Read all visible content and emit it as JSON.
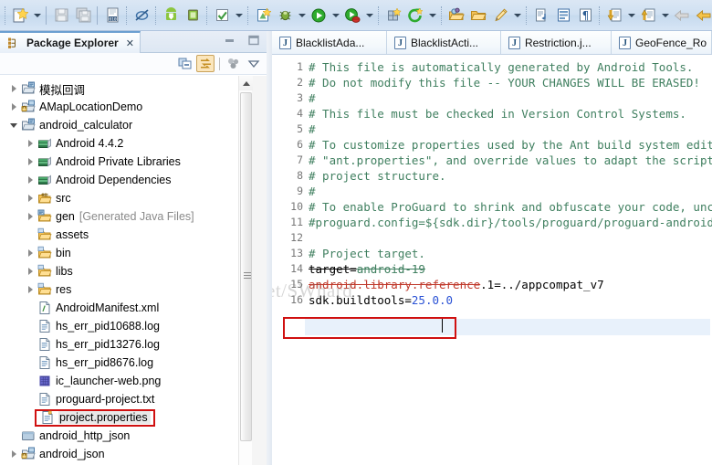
{
  "toolbar": {
    "items": [
      {
        "name": "new-wizard-button",
        "icon": "new-file-icon",
        "arrow": true
      },
      {
        "sep": "solid"
      },
      {
        "name": "save-button",
        "icon": "save-icon",
        "arrow": false
      },
      {
        "name": "save-all-button",
        "icon": "save-all-icon",
        "arrow": false
      },
      {
        "sep": "bar"
      },
      {
        "name": "open-hex-button",
        "icon": "binary-file-icon",
        "arrow": false
      },
      {
        "sep": "dot"
      },
      {
        "name": "skip-breakpoints-button",
        "icon": "skip-breakpoints-icon",
        "arrow": false
      },
      {
        "sep": "dot"
      },
      {
        "name": "android-sdk-manager-button",
        "icon": "android-download-icon",
        "arrow": false
      },
      {
        "name": "android-avd-manager-button",
        "icon": "android-device-icon",
        "arrow": false
      },
      {
        "sep": "dot"
      },
      {
        "name": "run-lint-button",
        "icon": "checkmark-icon",
        "arrow": true
      },
      {
        "sep": "dot"
      },
      {
        "name": "new-android-project-button",
        "icon": "new-android-icon",
        "arrow": false
      },
      {
        "name": "debug-button",
        "icon": "bug-icon",
        "arrow": true
      },
      {
        "name": "run-button",
        "icon": "run-play-icon",
        "arrow": true
      },
      {
        "name": "run-coverage-button",
        "icon": "coverage-icon",
        "arrow": true
      },
      {
        "sep": "dot"
      },
      {
        "name": "new-java-class-button",
        "icon": "new-class-icon",
        "arrow": false
      },
      {
        "name": "external-tools-button",
        "icon": "green-refresh-icon",
        "arrow": true
      },
      {
        "sep": "dot"
      },
      {
        "name": "open-type-button",
        "icon": "open-folder-search-icon",
        "arrow": false
      },
      {
        "name": "open-resource-button",
        "icon": "open-folder-icon",
        "arrow": false
      },
      {
        "name": "pen-annotate-button",
        "icon": "pen-icon",
        "arrow": true
      },
      {
        "sep": "dot"
      },
      {
        "name": "next-annotation-button",
        "icon": "next-edit-icon",
        "arrow": false
      },
      {
        "name": "toggle-block-selection-button",
        "icon": "block-selection-icon",
        "arrow": false
      },
      {
        "name": "show-whitespace-button",
        "icon": "pilcrow-icon",
        "arrow": false
      },
      {
        "sep": "dot"
      },
      {
        "name": "next-marker-button",
        "icon": "down-arrow-doc-icon",
        "arrow": true
      },
      {
        "name": "previous-marker-button",
        "icon": "up-arrow-doc-icon",
        "arrow": true
      },
      {
        "name": "back-navigation-button",
        "icon": "back-arrow-grey-icon",
        "arrow": false
      },
      {
        "name": "forward-navigation-button",
        "icon": "back-arrow-yellow-icon",
        "arrow": true
      }
    ]
  },
  "package_explorer": {
    "title": "Package Explorer",
    "close_glyph": "✕",
    "view_tools": [
      {
        "name": "collapse-all-button",
        "icon": "collapse-all-icon"
      },
      {
        "name": "link-with-editor-button",
        "icon": "link-editor-icon",
        "active": true
      },
      {
        "name": "focus-on-active-task-button",
        "icon": "focus-task-icon"
      },
      {
        "name": "view-menu-button",
        "icon": "chevron-down-icon"
      }
    ],
    "tree": [
      {
        "label": "模拟回调",
        "indent": 0,
        "twisty": "closed",
        "icon": "project-icon"
      },
      {
        "label": "AMapLocationDemo",
        "indent": 0,
        "twisty": "closed",
        "icon": "java-project-icon"
      },
      {
        "label": "android_calculator",
        "indent": 0,
        "twisty": "open",
        "icon": "project-icon"
      },
      {
        "label": "Android 4.4.2",
        "indent": 1,
        "twisty": "closed",
        "icon": "library-icon"
      },
      {
        "label": "Android Private Libraries",
        "indent": 1,
        "twisty": "closed",
        "icon": "library-icon"
      },
      {
        "label": "Android Dependencies",
        "indent": 1,
        "twisty": "closed",
        "icon": "library-icon"
      },
      {
        "label": "src",
        "indent": 1,
        "twisty": "closed",
        "icon": "source-folder-icon"
      },
      {
        "label": "gen",
        "indent": 1,
        "twisty": "closed",
        "icon": "gen-folder-icon",
        "suffix": "[Generated Java Files]"
      },
      {
        "label": "assets",
        "indent": 1,
        "twisty": "none",
        "icon": "folder-icon"
      },
      {
        "label": "bin",
        "indent": 1,
        "twisty": "closed",
        "icon": "folder-icon"
      },
      {
        "label": "libs",
        "indent": 1,
        "twisty": "closed",
        "icon": "folder-icon"
      },
      {
        "label": "res",
        "indent": 1,
        "twisty": "closed",
        "icon": "folder-icon"
      },
      {
        "label": "AndroidManifest.xml",
        "indent": 1,
        "twisty": "none",
        "icon": "xml-file-icon"
      },
      {
        "label": "hs_err_pid10688.log",
        "indent": 1,
        "twisty": "none",
        "icon": "text-file-icon"
      },
      {
        "label": "hs_err_pid13276.log",
        "indent": 1,
        "twisty": "none",
        "icon": "text-file-icon"
      },
      {
        "label": "hs_err_pid8676.log",
        "indent": 1,
        "twisty": "none",
        "icon": "text-file-icon"
      },
      {
        "label": "ic_launcher-web.png",
        "indent": 1,
        "twisty": "none",
        "icon": "image-file-icon"
      },
      {
        "label": "proguard-project.txt",
        "indent": 1,
        "twisty": "none",
        "icon": "text-file-icon"
      },
      {
        "label": "project.properties",
        "indent": 1,
        "twisty": "none",
        "icon": "properties-file-icon",
        "selected": true,
        "boxed": true
      },
      {
        "label": "android_http_json",
        "indent": 0,
        "twisty": "none",
        "icon": "closed-project-icon"
      },
      {
        "label": "android_json",
        "indent": 0,
        "twisty": "closed",
        "icon": "java-project-icon"
      }
    ]
  },
  "editor": {
    "tabs": [
      {
        "label": "BlacklistAda...",
        "icon": "java-file-icon"
      },
      {
        "label": "BlacklistActi...",
        "icon": "java-file-icon"
      },
      {
        "label": "Restriction.j...",
        "icon": "java-file-icon"
      },
      {
        "label": "GeoFence_Ro",
        "icon": "java-file-icon"
      }
    ],
    "lines": [
      {
        "n": 1,
        "text": "# This file is automatically generated by Android Tools.",
        "style": "comment"
      },
      {
        "n": 2,
        "text": "# Do not modify this file -- YOUR CHANGES WILL BE ERASED!",
        "style": "comment"
      },
      {
        "n": 3,
        "text": "#",
        "style": "comment"
      },
      {
        "n": 4,
        "text": "# This file must be checked in Version Control Systems.",
        "style": "comment"
      },
      {
        "n": 5,
        "text": "#",
        "style": "comment"
      },
      {
        "n": 6,
        "text": "# To customize properties used by the Ant build system edit",
        "style": "comment"
      },
      {
        "n": 7,
        "text": "# \"ant.properties\", and override values to adapt the script to yo",
        "style": "comment"
      },
      {
        "n": 8,
        "text": "# project structure.",
        "style": "comment"
      },
      {
        "n": 9,
        "text": "#",
        "style": "comment"
      },
      {
        "n": 10,
        "text": "# To enable ProGuard to shrink and obfuscate your code, uncomment",
        "style": "comment"
      },
      {
        "n": 11,
        "text": "#proguard.config=${sdk.dir}/tools/proguard/proguard-android.txt:p",
        "style": "comment"
      },
      {
        "n": 12,
        "text": "",
        "style": "plain"
      },
      {
        "n": 13,
        "text": "# Project target.",
        "style": "comment"
      },
      {
        "n": 14,
        "key": "target=",
        "value": "android-19",
        "style": "property-struck"
      },
      {
        "n": 15,
        "key": "android.library.reference",
        "value": ".1=../appcompat_v7",
        "style": "property-struck-red"
      },
      {
        "n": 16,
        "key": "sdk.buildtools=",
        "value": "25.0.0",
        "style": "property-active"
      }
    ]
  },
  "watermark": "http://blog.csdn.net/SWhard",
  "colors": {
    "comment": "#3f7f5f",
    "value": "#2a52d5",
    "highlight_box": "#d01010",
    "line_highlight": "#e8f1fb",
    "toolbar_bg": "#cfe0f2"
  }
}
